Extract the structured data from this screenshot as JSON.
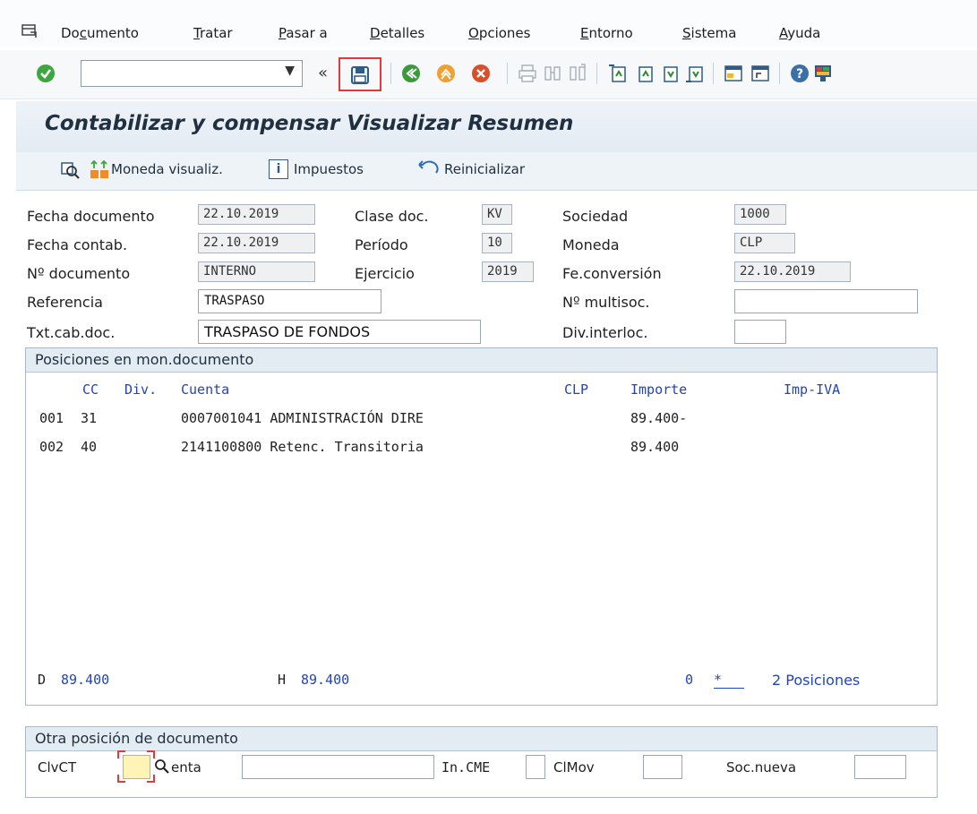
{
  "menu": {
    "items": [
      {
        "pre": "Do",
        "u": "c",
        "post": "umento"
      },
      {
        "pre": "",
        "u": "T",
        "post": "ratar"
      },
      {
        "pre": "",
        "u": "P",
        "post": "asar a"
      },
      {
        "pre": "",
        "u": "D",
        "post": "etalles"
      },
      {
        "pre": "",
        "u": "O",
        "post": "pciones"
      },
      {
        "pre": "",
        "u": "E",
        "post": "ntorno"
      },
      {
        "pre": "",
        "u": "S",
        "post": "istema"
      },
      {
        "pre": "",
        "u": "A",
        "post": "yuda"
      }
    ]
  },
  "toolbar": {
    "command_value": "",
    "history_label": "«"
  },
  "title": "Contabilizar y compensar Visualizar Resumen",
  "app_toolbar": {
    "currency_label": "Moneda visualiz.",
    "taxes_label": "Impuestos",
    "reset_label": "Reinicializar"
  },
  "header": {
    "fecha_documento_label": "Fecha documento",
    "fecha_documento": "22.10.2019",
    "fecha_contab_label": "Fecha contab.",
    "fecha_contab": "22.10.2019",
    "no_documento_label": "Nº documento",
    "no_documento": "INTERNO",
    "referencia_label": "Referencia",
    "referencia": "TRASPASO",
    "txt_cab_label": "Txt.cab.doc.",
    "txt_cab": "TRASPASO DE FONDOS",
    "clase_doc_label": "Clase doc.",
    "clase_doc": "KV",
    "periodo_label": "Período",
    "periodo": "10",
    "ejercicio_label": "Ejercicio",
    "ejercicio": "2019",
    "sociedad_label": "Sociedad",
    "sociedad": "1000",
    "moneda_label": "Moneda",
    "moneda": "CLP",
    "fe_conversion_label": "Fe.conversión",
    "fe_conversion": "22.10.2019",
    "no_multisoc_label": "Nº multisoc.",
    "no_multisoc": "",
    "div_interloc_label": "Div.interloc.",
    "div_interloc": ""
  },
  "positions": {
    "title": "Posiciones en mon.documento",
    "columns": {
      "cc": "CC",
      "div": "Div.",
      "cuenta": "Cuenta",
      "clp": "CLP",
      "importe": "Importe",
      "imp_iva": "Imp-IVA"
    },
    "rows": [
      {
        "pos": "001",
        "cc": "31",
        "cuenta": "0007001041 ADMINISTRACIÓN DIRE",
        "importe": "89.400-"
      },
      {
        "pos": "002",
        "cc": "40",
        "cuenta": "2141100800 Retenc. Transitoria",
        "importe": "89.400"
      }
    ],
    "footer": {
      "debit_label": "D",
      "debit": "89.400",
      "credit_label": "H",
      "credit": "89.400",
      "balance": "0",
      "star": "*",
      "count_text": "2 Posiciones"
    }
  },
  "other_position": {
    "title": "Otra posición de documento",
    "clvct_label": "ClvCT",
    "clvct_value": "",
    "cuenta_label": "enta",
    "cuenta_value": "",
    "in_cme_label": "In.CME",
    "in_cme_value": "",
    "clmov_label": "ClMov",
    "clmov_value": "",
    "soc_nueva_label": "Soc.nueva",
    "soc_nueva_value": ""
  },
  "colors": {
    "accent_blue": "#2244bb",
    "highlight_red": "#e23a3a",
    "field_yellow": "#fff3b8"
  }
}
